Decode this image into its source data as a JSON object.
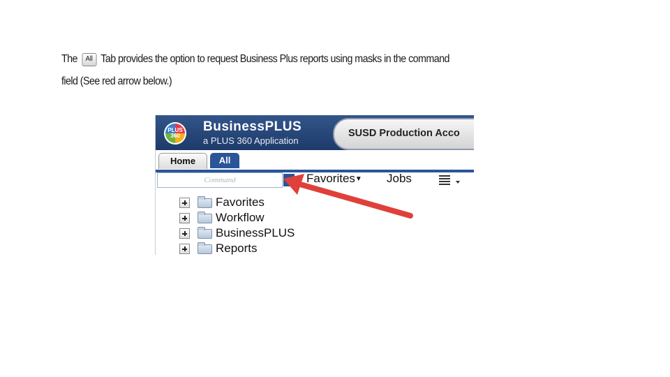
{
  "instructions": {
    "line1_before": "The",
    "all_chip_label": "All",
    "line1_after": "Tab provides the option to request Business Plus reports using masks in the command",
    "line2": "field (See red arrow below.)"
  },
  "app": {
    "logo_text": "PLUS 360",
    "title": "BusinessPLUS",
    "subtitle": "a PLUS 360 Application",
    "environment": "SUSD Production Acco"
  },
  "tabs": [
    {
      "label": "Home"
    },
    {
      "label": "All"
    }
  ],
  "command": {
    "placeholder": "Command"
  },
  "menus": {
    "favorites": "Favorites",
    "jobs": "Jobs"
  },
  "tree": [
    {
      "label": "Favorites"
    },
    {
      "label": "Workflow"
    },
    {
      "label": "BusinessPLUS"
    },
    {
      "label": "Reports"
    }
  ],
  "colors": {
    "arrow": "#e0403a",
    "header": "#1d3a6a",
    "tab_active": "#2a5598"
  },
  "icons": {
    "arrow": "red-arrow-icon",
    "expand": "plus-box-icon",
    "folder": "folder-icon",
    "menu": "list-menu-icon"
  }
}
